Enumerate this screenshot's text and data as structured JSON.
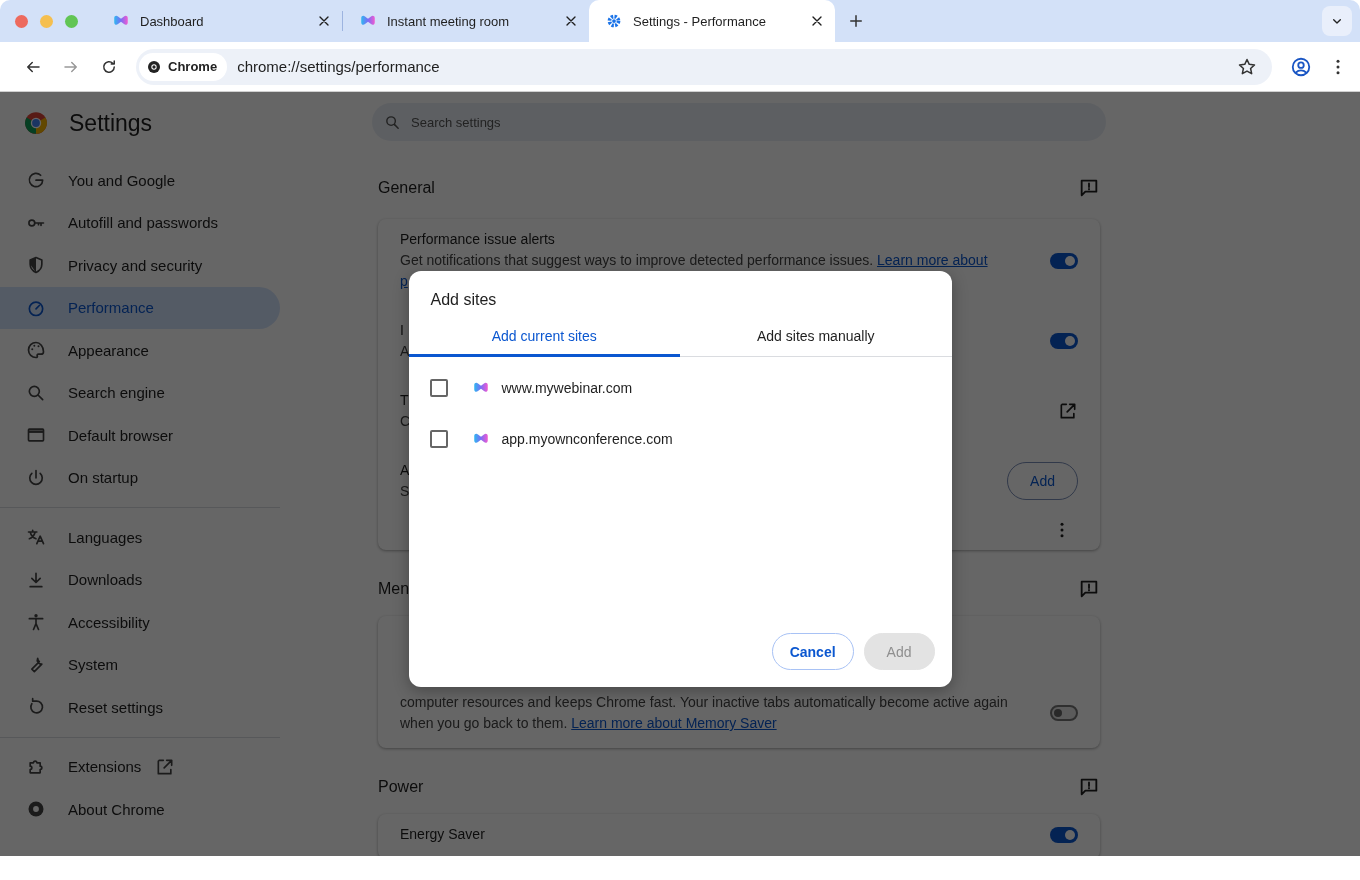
{
  "tabs": [
    {
      "title": "Dashboard",
      "kind": "app",
      "selected": false
    },
    {
      "title": "Instant meeting room",
      "kind": "app",
      "selected": false
    },
    {
      "title": "Settings - Performance",
      "kind": "settings",
      "selected": true
    }
  ],
  "address_bar": {
    "chip": "Chrome",
    "url": "chrome://settings/performance"
  },
  "sidebar": {
    "title": "Settings",
    "groups": [
      [
        {
          "label": "You and Google",
          "selected": false
        },
        {
          "label": "Autofill and passwords",
          "selected": false
        },
        {
          "label": "Privacy and security",
          "selected": false
        },
        {
          "label": "Performance",
          "selected": true
        },
        {
          "label": "Appearance",
          "selected": false
        },
        {
          "label": "Search engine",
          "selected": false
        },
        {
          "label": "Default browser",
          "selected": false
        },
        {
          "label": "On startup",
          "selected": false
        }
      ],
      [
        {
          "label": "Languages",
          "selected": false
        },
        {
          "label": "Downloads",
          "selected": false
        },
        {
          "label": "Accessibility",
          "selected": false
        },
        {
          "label": "System",
          "selected": false
        },
        {
          "label": "Reset settings",
          "selected": false
        }
      ],
      [
        {
          "label": "Extensions",
          "selected": false
        },
        {
          "label": "About Chrome",
          "selected": false
        }
      ]
    ]
  },
  "search": {
    "placeholder": "Search settings"
  },
  "sections": [
    {
      "heading": "General",
      "rows": [
        {
          "kind": "toggle",
          "on": true,
          "title": "Performance issue alerts",
          "lines": [
            {
              "text": "Get notifications that suggest ways to improve detected performance issues. ",
              "link": "Learn more about"
            },
            {
              "link": "p"
            }
          ]
        },
        {
          "kind": "toggle",
          "on": true,
          "title": "I",
          "lines": [
            {
              "text": "A"
            }
          ]
        },
        {
          "kind": "external",
          "title": "T",
          "lines": [
            {
              "text": "C"
            }
          ]
        },
        {
          "kind": "button",
          "button": "Add",
          "title": "A",
          "lines": [
            {
              "text": "S"
            }
          ]
        },
        {
          "kind": "menu"
        }
      ]
    },
    {
      "heading": "Men",
      "rows": [
        {
          "kind": "toggle",
          "on": false,
          "lines": [
            {
              "text": "computer resources and keeps Chrome fast. Your inactive tabs automatically become active again"
            },
            {
              "text": "when you go back to them. ",
              "link": "Learn more about Memory Saver"
            }
          ]
        }
      ]
    },
    {
      "heading": "Power",
      "rows": [
        {
          "kind": "toggle",
          "on": true,
          "title": "Energy Saver"
        }
      ]
    }
  ],
  "dialog": {
    "title": "Add sites",
    "tabs": [
      {
        "label": "Add current sites",
        "selected": true
      },
      {
        "label": "Add sites manually",
        "selected": false
      }
    ],
    "sites": [
      {
        "url": "www.mywebinar.com",
        "checked": false
      },
      {
        "url": "app.myownconference.com",
        "checked": false
      }
    ],
    "buttons": [
      {
        "label": "Cancel",
        "kind": "secondary",
        "disabled": false
      },
      {
        "label": "Add",
        "kind": "primary",
        "disabled": true
      }
    ]
  }
}
